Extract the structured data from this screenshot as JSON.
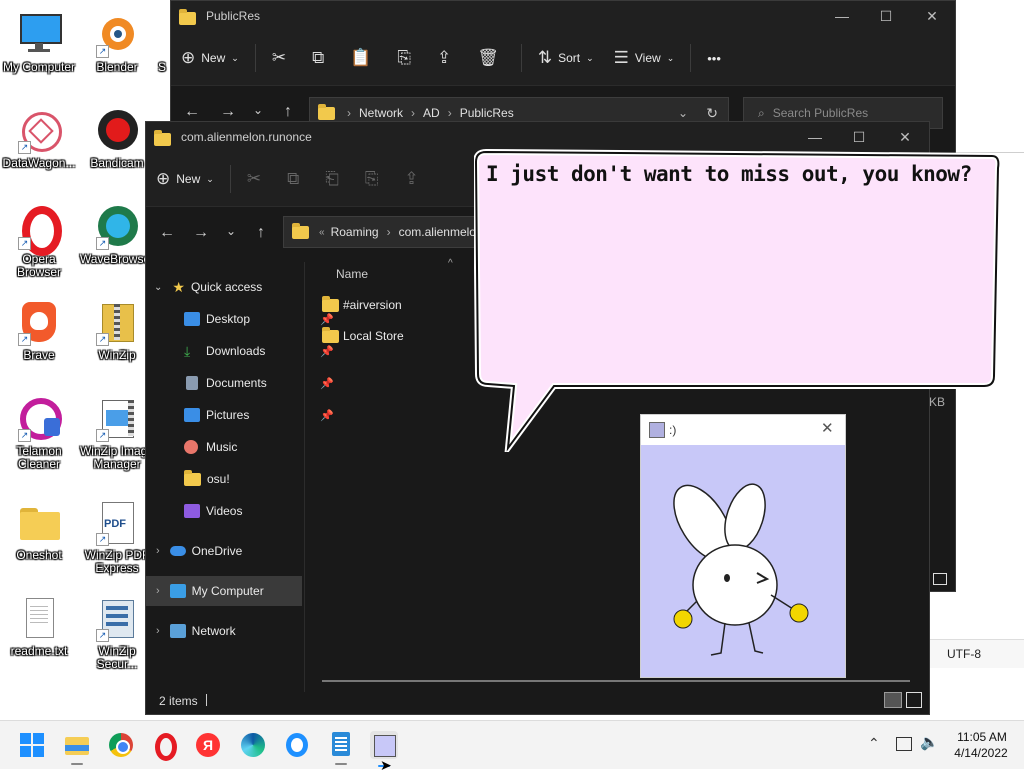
{
  "desktop": {
    "icons": [
      {
        "label": "My Computer"
      },
      {
        "label": "Blender"
      },
      {
        "label": "DataWagon..."
      },
      {
        "label": "Bandicam"
      },
      {
        "label": "Opera Browser"
      },
      {
        "label": "WaveBrowser"
      },
      {
        "label": "Brave"
      },
      {
        "label": "WinZip"
      },
      {
        "label": "Telamon Cleaner"
      },
      {
        "label": "WinZip Image Manager"
      },
      {
        "label": "Oneshot"
      },
      {
        "label": "WinZip PDF Express"
      },
      {
        "label": "readme.txt"
      },
      {
        "label": "WinZip Secur..."
      },
      {
        "label": "S"
      }
    ]
  },
  "back_window": {
    "title": "PublicRes",
    "cmd": {
      "new": "New",
      "sort": "Sort",
      "view": "View",
      "more": "•••"
    },
    "breadcrumb": [
      "Network",
      "AD",
      "PublicRes"
    ],
    "search_placeholder": "Search PublicRes",
    "size_fragment": "KB"
  },
  "front_window": {
    "title": "com.alienmelon.runonce",
    "cmd": {
      "new": "New"
    },
    "breadcrumb": [
      "Roaming",
      "com.alienmelo"
    ],
    "column_name": "Name",
    "files": [
      "#airversion",
      "Local Store"
    ],
    "sidebar": {
      "quick_access": "Quick access",
      "items": [
        {
          "label": "Desktop",
          "color": "#3a8ee6"
        },
        {
          "label": "Downloads",
          "color": "#3fb24f"
        },
        {
          "label": "Documents",
          "color": "#8a9bb0"
        },
        {
          "label": "Pictures",
          "color": "#3a8ee6"
        },
        {
          "label": "Music",
          "color": "#e8766a"
        },
        {
          "label": "osu!",
          "color": "#f2c94c"
        },
        {
          "label": "Videos",
          "color": "#8e5be0"
        }
      ],
      "onedrive": "OneDrive",
      "mycomputer": "My Computer",
      "network": "Network"
    },
    "status": "2 items"
  },
  "notepad_fragment": {
    "encoding": "UTF-8"
  },
  "speech_bubble": {
    "text": "I just don't want to miss out, you know?"
  },
  "bunny_window": {
    "title": ":)",
    "bg": "#c8c8f8"
  },
  "taskbar": {
    "time": "11:05 AM",
    "date": "4/14/2022",
    "apps": [
      "start-icon",
      "file-explorer-icon",
      "chrome-icon",
      "opera-icon",
      "yandex-icon",
      "edge-icon",
      "brave-icon",
      "notepad-icon",
      "bunny-app-icon"
    ]
  }
}
